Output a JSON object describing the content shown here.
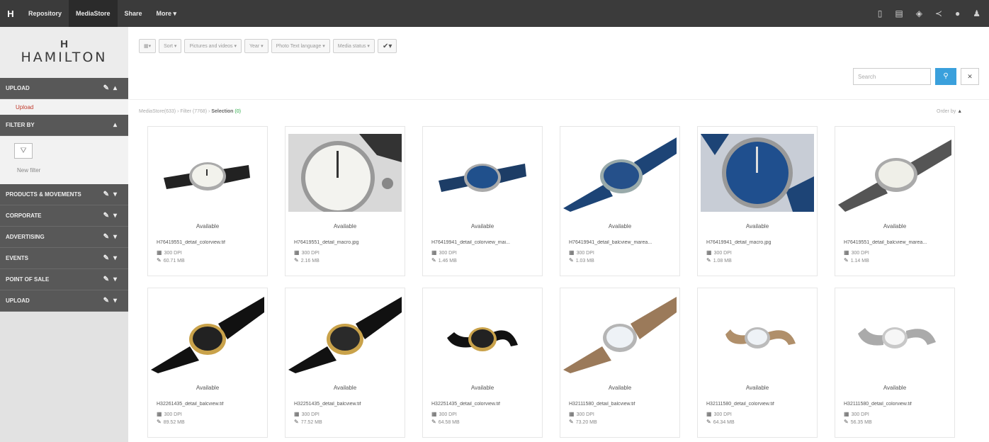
{
  "topbar": {
    "logo": "H",
    "nav": [
      "Repository",
      "MediaStore",
      "Share",
      "More ▾"
    ],
    "active": "MediaStore",
    "icons": [
      "document-icon",
      "copy-icon",
      "cube-icon",
      "share-icon",
      "comment-icon",
      "user-icon"
    ]
  },
  "sidebar": {
    "brand_mark": "H",
    "brand_name": "HAMILTON",
    "sections": [
      {
        "label": "UPLOAD"
      },
      {
        "label": "FILTER BY"
      },
      {
        "label": "PRODUCTS & MOVEMENTS"
      },
      {
        "label": "CORPORATE"
      },
      {
        "label": "ADVERTISING"
      },
      {
        "label": "EVENTS"
      },
      {
        "label": "POINT OF SALE"
      },
      {
        "label": "UPLOAD"
      }
    ],
    "upload_link": "Upload",
    "new_filter": "New filter"
  },
  "toolbar": {
    "buttons": [
      "Sort ▾",
      "Pictures and videos ▾",
      "Year ▾",
      "Photo Text language ▾",
      "Media status ▾"
    ],
    "search_placeholder": "Search"
  },
  "breadcrumb": {
    "path": "MediaStore(633) › Filter (7768) › ",
    "selection": "Selection",
    "count": "(0)",
    "order_by": "Order by"
  },
  "cards": [
    {
      "status": "Available",
      "file": "H76419551_detail_colorview.tif",
      "dpi": "300 DPI",
      "size": "60.71 MB",
      "style": "silver-black"
    },
    {
      "status": "Available",
      "file": "H76419551_detail_macro.jpg",
      "dpi": "300 DPI",
      "size": "2.16 MB",
      "style": "closeup-white"
    },
    {
      "status": "Available",
      "file": "H76419941_detail_colorview_mai...",
      "dpi": "300 DPI",
      "size": "1.46 MB",
      "style": "blue-blue"
    },
    {
      "status": "Available",
      "file": "H76419941_detail_balcview_marea...",
      "dpi": "300 DPI",
      "size": "1.03 MB",
      "style": "blue-nato"
    },
    {
      "status": "Available",
      "file": "H76419941_detail_macro.jpg",
      "dpi": "300 DPI",
      "size": "1.08 MB",
      "style": "closeup-blue"
    },
    {
      "status": "Available",
      "file": "H76419551_detail_balcview_marea...",
      "dpi": "300 DPI",
      "size": "1.14 MB",
      "style": "grey-nato"
    },
    {
      "status": "Available",
      "file": "H32261435_detail_balcview.tif",
      "dpi": "300 DPI",
      "size": "89.52 MB",
      "style": "gold-black"
    },
    {
      "status": "Available",
      "file": "H32251435_detail_balcview.tif",
      "dpi": "300 DPI",
      "size": "77.52 MB",
      "style": "gold-black2"
    },
    {
      "status": "Available",
      "file": "H32251435_detail_colorview.tif",
      "dpi": "300 DPI",
      "size": "64.58 MB",
      "style": "gold-cuff"
    },
    {
      "status": "Available",
      "file": "H32111580_detail_balcview.tif",
      "dpi": "300 DPI",
      "size": "73.20 MB",
      "style": "silver-tan"
    },
    {
      "status": "Available",
      "file": "H32111580_detail_colorview.tif",
      "dpi": "300 DPI",
      "size": "64.34 MB",
      "style": "silver-tan-cuff"
    },
    {
      "status": "Available",
      "file": "H32111580_detail_colorview.tif",
      "dpi": "300 DPI",
      "size": "56.35 MB",
      "style": "bracelet"
    }
  ]
}
